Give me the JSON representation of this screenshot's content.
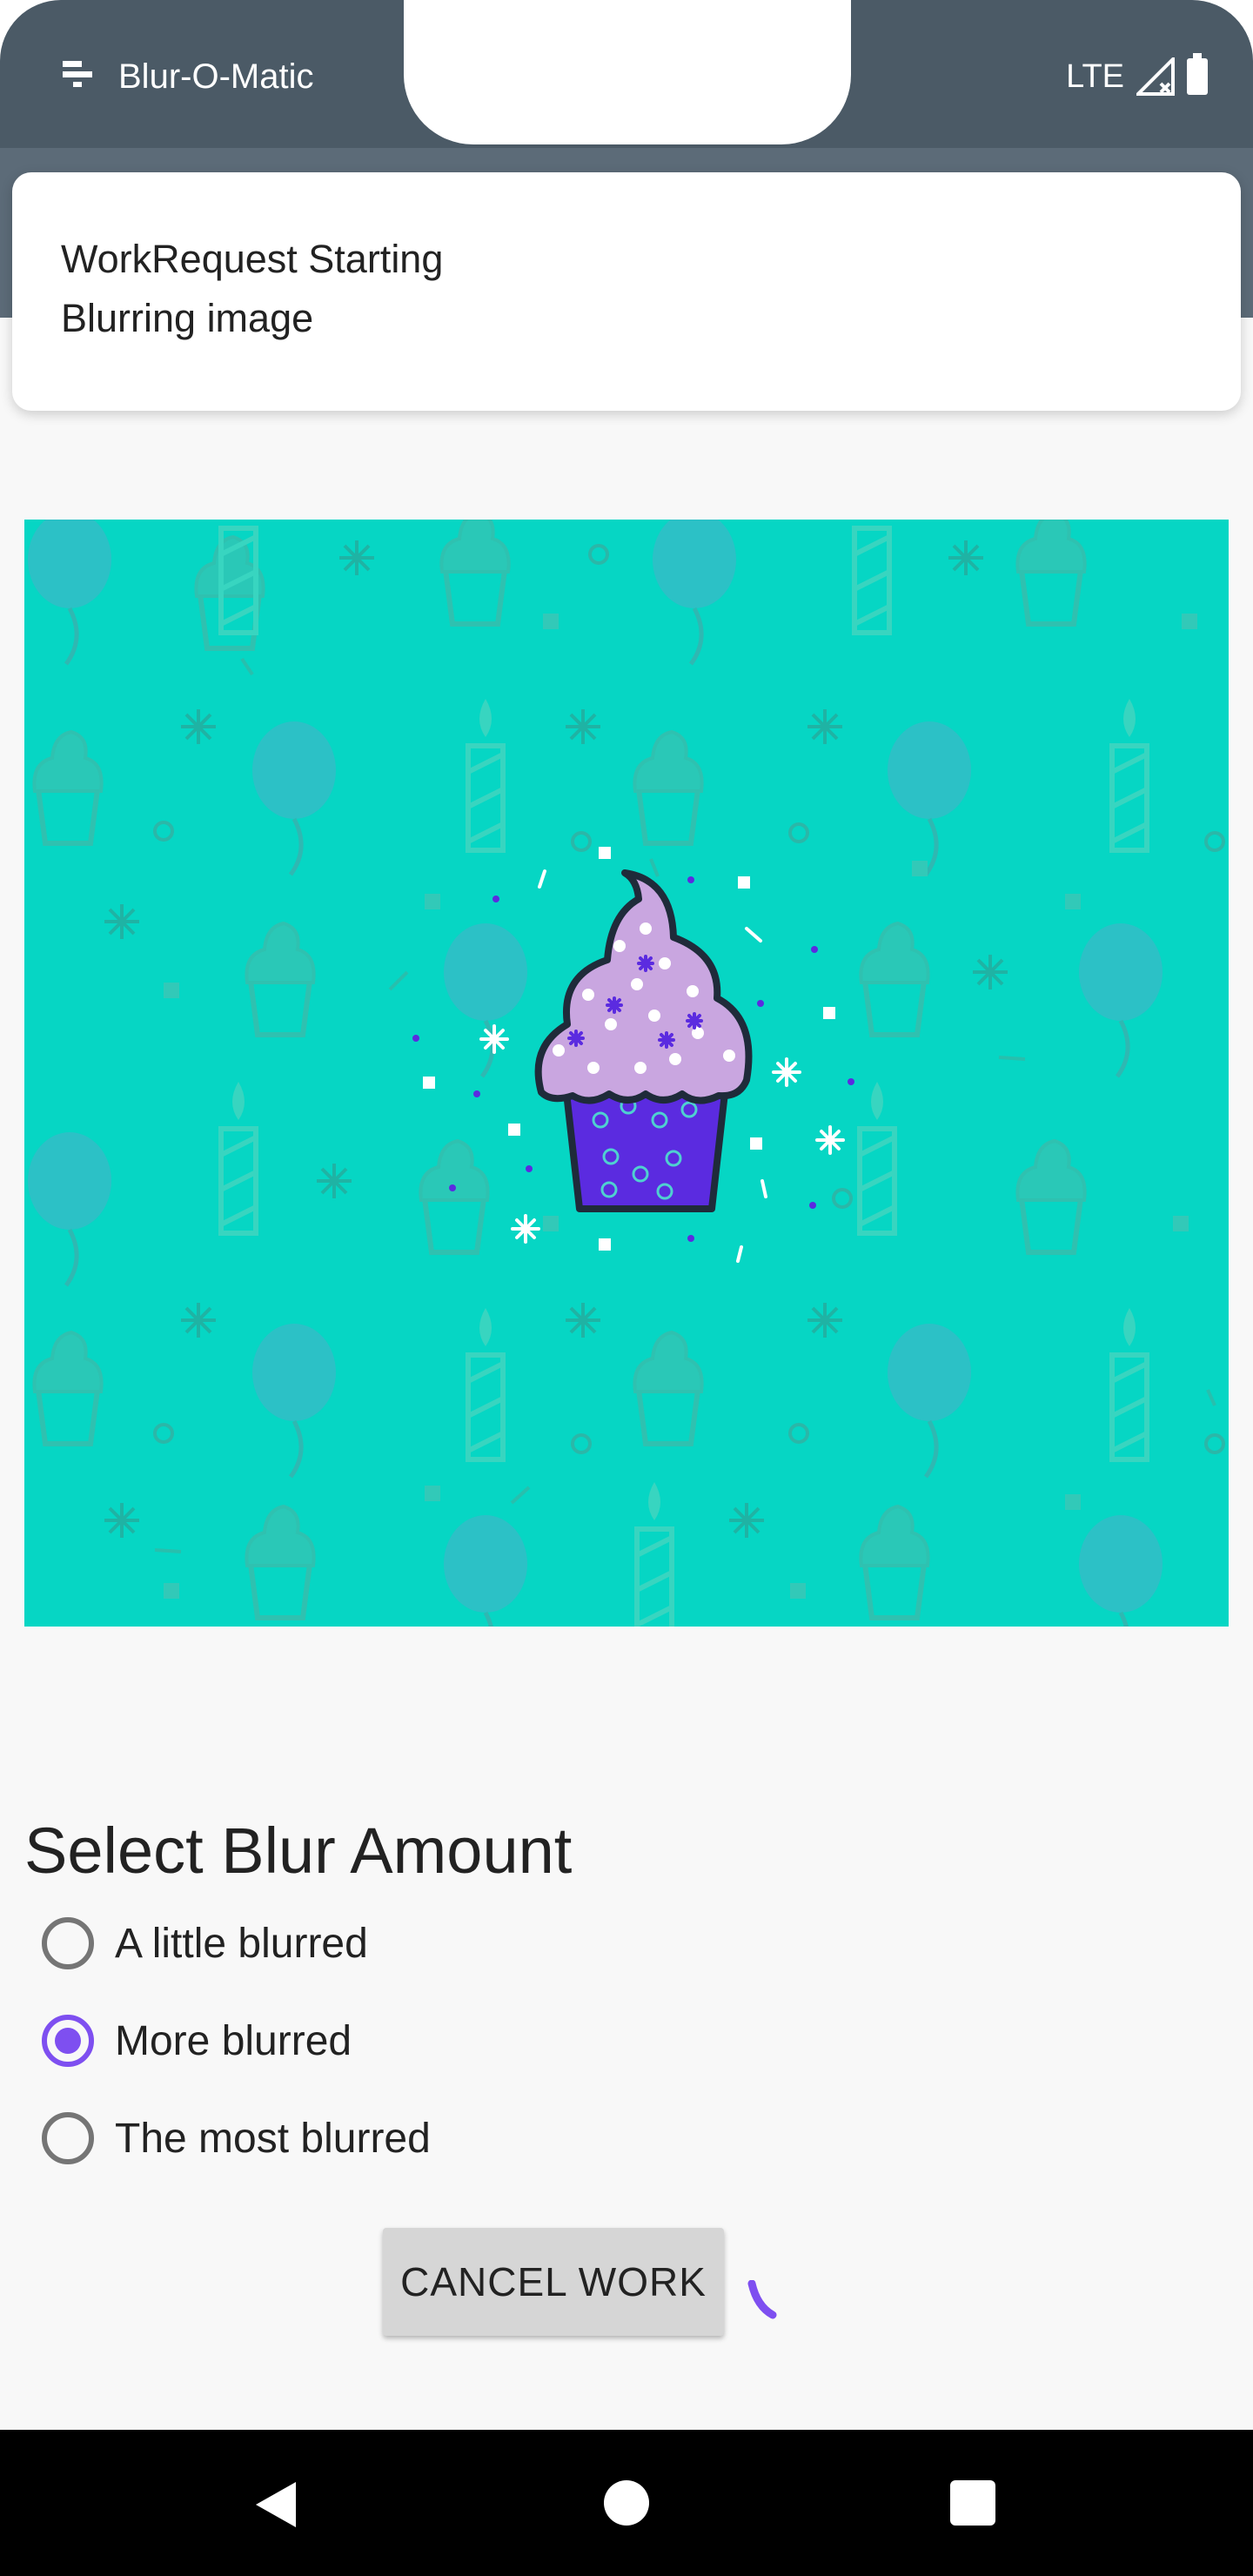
{
  "status_bar": {
    "app_name": "Blur-O-Matic",
    "network": "LTE"
  },
  "notification": {
    "title": "WorkRequest Starting",
    "text": "Blurring image"
  },
  "image": {
    "subject": "cupcake",
    "background_color": "#06d6c4",
    "accent_color": "#7e4ff0"
  },
  "blur": {
    "title": "Select Blur Amount",
    "options": [
      {
        "label": "A little blurred",
        "selected": false
      },
      {
        "label": "More blurred",
        "selected": true
      },
      {
        "label": "The most blurred",
        "selected": false
      }
    ]
  },
  "actions": {
    "cancel_label": "CANCEL WORK"
  },
  "icons": {
    "status_app": "app-notification-icon",
    "signal": "signal-icon",
    "battery": "battery-icon",
    "nav_back": "back-icon",
    "nav_home": "home-icon",
    "nav_recent": "recents-icon"
  }
}
